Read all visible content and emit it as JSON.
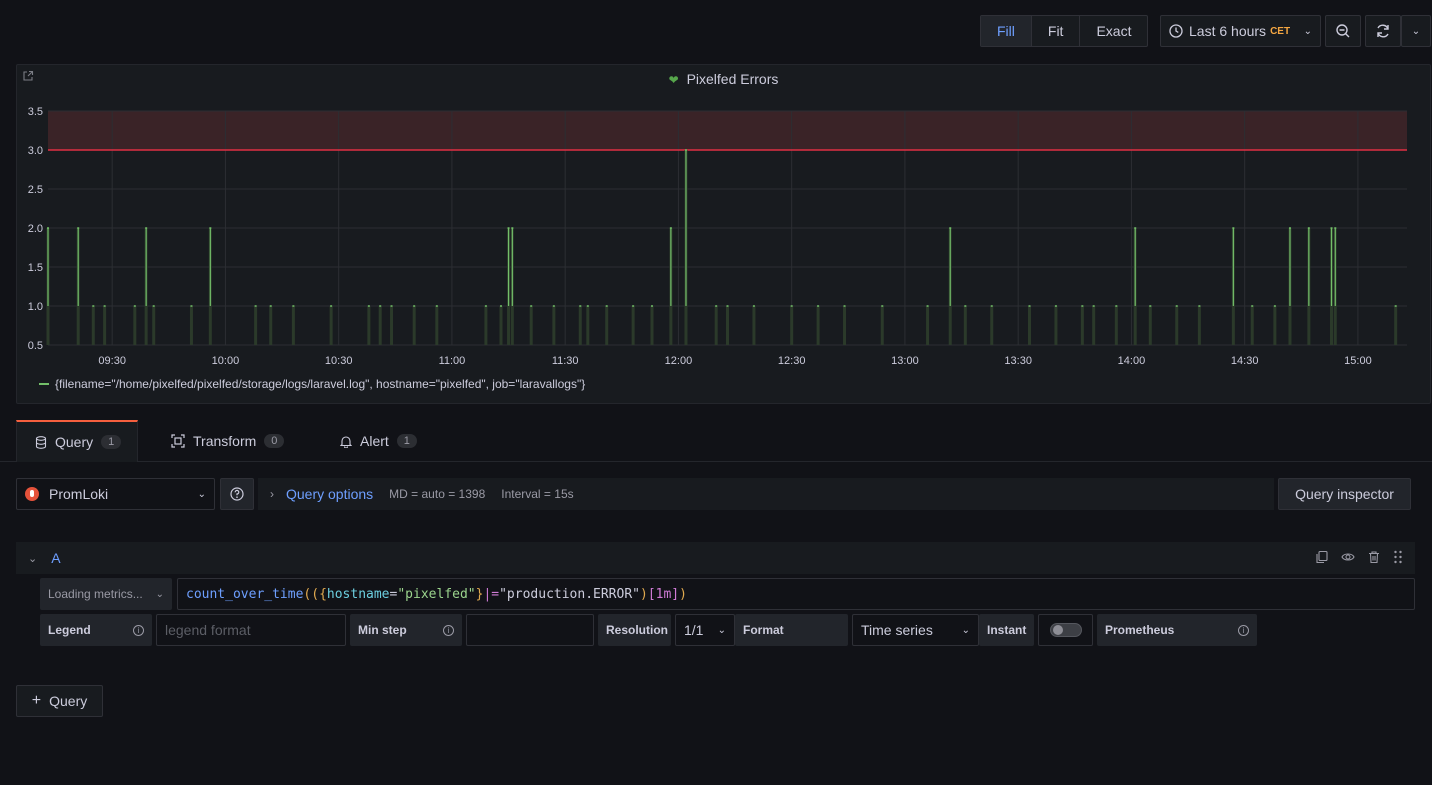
{
  "toolbar": {
    "view_modes": [
      "Fill",
      "Fit",
      "Exact"
    ],
    "active_view_mode": "Fill",
    "time_range": "Last 6 hours",
    "timezone": "CET"
  },
  "panel": {
    "title": "Pixelfed Errors",
    "legend_label": "{filename=\"/home/pixelfed/pixelfed/storage/logs/laravel.log\", hostname=\"pixelfed\", job=\"laravallogs\"}"
  },
  "tabs": [
    {
      "label": "Query",
      "count": "1"
    },
    {
      "label": "Transform",
      "count": "0"
    },
    {
      "label": "Alert",
      "count": "1"
    }
  ],
  "query_editor": {
    "datasource": "PromLoki",
    "query_options_label": "Query options",
    "md_text": "MD = auto = 1398",
    "interval_text": "Interval = 15s",
    "inspector_label": "Query inspector",
    "ref_id": "A",
    "metrics_button": "Loading metrics...",
    "query_tokens": {
      "fn": "count_over_time",
      "p1": "((",
      "b1": "{",
      "label": "hostname",
      "eq": "=",
      "label_value": "\"pixelfed\"",
      "b2": "}",
      "op": "|=",
      "filter": "\"production.ERROR\"",
      "p2": ")",
      "range": "[1m]",
      "p3": ")"
    },
    "legend_label": "Legend",
    "legend_placeholder": "legend format",
    "min_step_label": "Min step",
    "resolution_label": "Resolution",
    "resolution_value": "1/1",
    "format_label": "Format",
    "format_value": "Time series",
    "instant_label": "Instant",
    "prometheus_label": "Prometheus",
    "add_query_label": "Query"
  },
  "colors": {
    "series": "#73bf69",
    "threshold_line": "#e02f44",
    "threshold_fill": "#3a2327",
    "accent": "#6e9fff",
    "tab_active": "#f55f3e"
  },
  "chart_data": {
    "type": "line",
    "title": "Pixelfed Errors",
    "x_ticks": [
      "09:30",
      "10:00",
      "10:30",
      "11:00",
      "11:30",
      "12:00",
      "12:30",
      "13:00",
      "13:30",
      "14:00",
      "14:30",
      "15:00"
    ],
    "y_ticks": [
      "0.5",
      "1.0",
      "1.5",
      "2.0",
      "2.5",
      "3.0",
      "3.5"
    ],
    "xlim": [
      "09:13",
      "15:13"
    ],
    "ylim": [
      0.5,
      3.5
    ],
    "threshold": 3.0,
    "grid": true,
    "legend_position": "bottom-left",
    "series": [
      {
        "name": "{filename=\"/home/pixelfed/pixelfed/storage/logs/laravel.log\", hostname=\"pixelfed\", job=\"laravallogs\"}",
        "points": [
          [
            "09:13",
            2
          ],
          [
            "09:21",
            2
          ],
          [
            "09:25",
            1
          ],
          [
            "09:28",
            1
          ],
          [
            "09:36",
            1
          ],
          [
            "09:39",
            2
          ],
          [
            "09:41",
            1
          ],
          [
            "09:51",
            1
          ],
          [
            "09:56",
            2
          ],
          [
            "10:08",
            1
          ],
          [
            "10:12",
            1
          ],
          [
            "10:18",
            1
          ],
          [
            "10:28",
            1
          ],
          [
            "10:38",
            1
          ],
          [
            "10:41",
            1
          ],
          [
            "10:44",
            1
          ],
          [
            "10:50",
            1
          ],
          [
            "10:56",
            1
          ],
          [
            "11:09",
            1
          ],
          [
            "11:13",
            1
          ],
          [
            "11:15",
            2
          ],
          [
            "11:16",
            2
          ],
          [
            "11:21",
            1
          ],
          [
            "11:27",
            1
          ],
          [
            "11:34",
            1
          ],
          [
            "11:36",
            1
          ],
          [
            "11:41",
            1
          ],
          [
            "11:48",
            1
          ],
          [
            "11:53",
            1
          ],
          [
            "11:58",
            2
          ],
          [
            "12:02",
            3
          ],
          [
            "12:10",
            1
          ],
          [
            "12:13",
            1
          ],
          [
            "12:20",
            1
          ],
          [
            "12:30",
            1
          ],
          [
            "12:37",
            1
          ],
          [
            "12:44",
            1
          ],
          [
            "12:54",
            1
          ],
          [
            "13:06",
            1
          ],
          [
            "13:12",
            2
          ],
          [
            "13:16",
            1
          ],
          [
            "13:23",
            1
          ],
          [
            "13:33",
            1
          ],
          [
            "13:40",
            1
          ],
          [
            "13:47",
            1
          ],
          [
            "13:50",
            1
          ],
          [
            "13:56",
            1
          ],
          [
            "14:01",
            2
          ],
          [
            "14:05",
            1
          ],
          [
            "14:12",
            1
          ],
          [
            "14:18",
            1
          ],
          [
            "14:27",
            2
          ],
          [
            "14:32",
            1
          ],
          [
            "14:38",
            1
          ],
          [
            "14:42",
            2
          ],
          [
            "14:47",
            2
          ],
          [
            "14:53",
            2
          ],
          [
            "14:54",
            2
          ],
          [
            "15:10",
            1
          ]
        ]
      }
    ]
  }
}
